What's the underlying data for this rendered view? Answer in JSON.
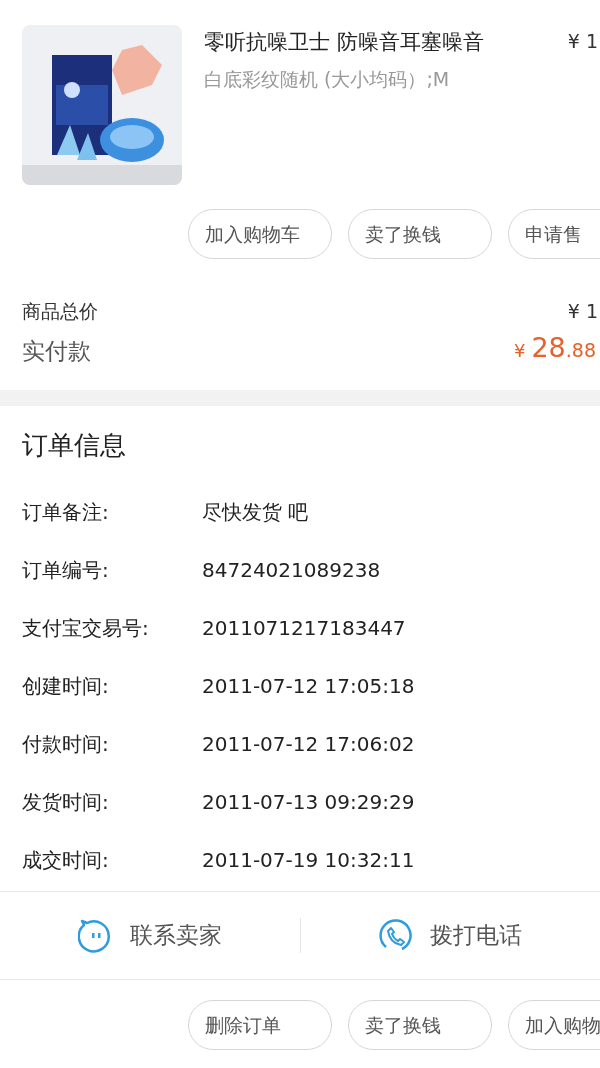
{
  "product": {
    "title": "零听抗噪卫士 防噪音耳塞噪音",
    "price": "¥ 1",
    "spec": "白底彩纹随机 (大小均码）;M"
  },
  "item_actions": [
    "加入购物车",
    "卖了换钱",
    "申请售"
  ],
  "totals": {
    "goods_label": "商品总价",
    "goods_value": "¥ 1",
    "paid_label": "实付款",
    "paid_currency": "¥",
    "paid_integer": "28",
    "paid_decimal": ".88"
  },
  "order_info": {
    "title": "订单信息",
    "rows": [
      {
        "label": "订单备注:",
        "value": "尽快发货 吧"
      },
      {
        "label": "订单编号:",
        "value": "84724021089238"
      },
      {
        "label": "支付宝交易号:",
        "value": "2011071217183447"
      },
      {
        "label": "创建时间:",
        "value": "2011-07-12 17:05:18"
      },
      {
        "label": "付款时间:",
        "value": "2011-07-12 17:06:02"
      },
      {
        "label": "发货时间:",
        "value": "2011-07-13 09:29:29"
      },
      {
        "label": "成交时间:",
        "value": "2011-07-19 10:32:11"
      }
    ]
  },
  "contact": [
    {
      "kind": "chat",
      "label": "联系卖家"
    },
    {
      "kind": "phone",
      "label": "拨打电话"
    }
  ],
  "order_actions": [
    "删除订单",
    "卖了换钱",
    "加入购物"
  ]
}
